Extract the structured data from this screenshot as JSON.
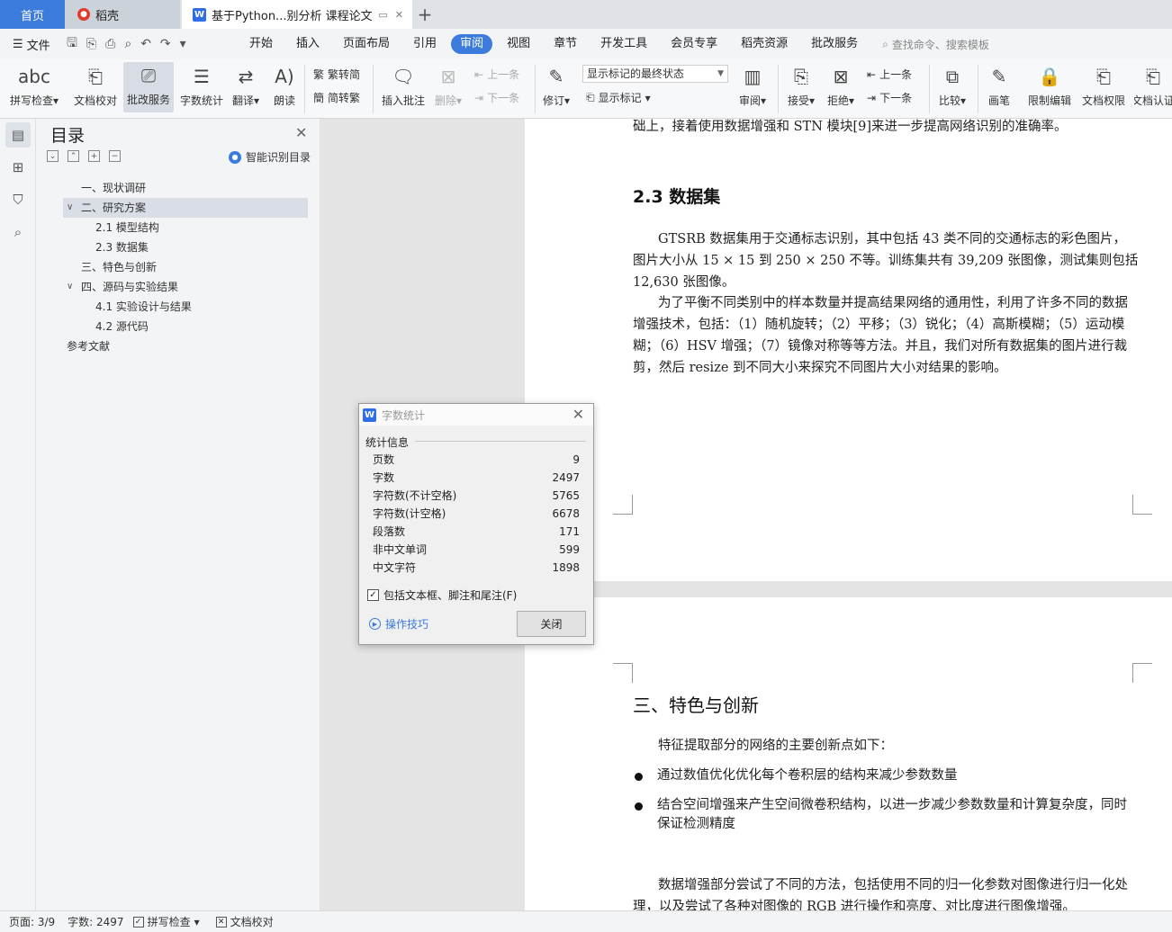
{
  "tabs": {
    "home": "首页",
    "daoke": "稻壳",
    "doc": "基于Python...别分析 课程论文",
    "new": "+"
  },
  "menubar": {
    "file": "文件",
    "items": [
      "开始",
      "插入",
      "页面布局",
      "引用",
      "审阅",
      "视图",
      "章节",
      "开发工具",
      "会员专享",
      "稻壳资源",
      "批改服务"
    ],
    "active": "审阅",
    "search_placeholder": "查找命令、搜索模板"
  },
  "ribbon": {
    "spellcheck": "拼写检查",
    "doc_proof": "文档校对",
    "correct_service": "批改服务",
    "word_count": "字数统计",
    "translate": "翻译",
    "read_aloud": "朗读",
    "trad_to_simp": "繁转简",
    "simp_to_trad": "简转繁",
    "insert_comment": "插入批注",
    "delete": "删除",
    "prev": "上一条",
    "next": "下一条",
    "revise": "修订",
    "markup_state": "显示标记的最终状态",
    "show_markup": "显示标记",
    "review": "审阅",
    "accept": "接受",
    "reject": "拒绝",
    "prev2": "上一条",
    "next2": "下一条",
    "compare": "比较",
    "pen": "画笔",
    "restrict_edit": "限制编辑",
    "doc_rights": "文档权限",
    "doc_cert": "文档认证"
  },
  "toc": {
    "title": "目录",
    "smart": "智能识别目录",
    "items": [
      {
        "label": "一、现状调研",
        "level": 1,
        "expanded": null
      },
      {
        "label": "二、研究方案",
        "level": 1,
        "expanded": true,
        "selected": true
      },
      {
        "label": "2.1  模型结构",
        "level": 2
      },
      {
        "label": "2.3  数据集",
        "level": 2
      },
      {
        "label": "三、特色与创新",
        "level": 1
      },
      {
        "label": "四、源码与实验结果",
        "level": 1,
        "expanded": true
      },
      {
        "label": "4.1  实验设计与结果",
        "level": 2
      },
      {
        "label": "4.2  源代码",
        "level": 2
      },
      {
        "label": "参考文献",
        "level": 0
      }
    ]
  },
  "document": {
    "line_top": "础上，接着使用数据增强和 STN 模块[9]来进一步提高网络识别的准确率。",
    "h_dataset": "2.3  数据集",
    "p1": "GTSRB 数据集用于交通标志识别，其中包括 43 类不同的交通标志的彩色图片，图片大小从 15 × 15 到 250 × 250 不等。训练集共有 39,209 张图像，测试集则包括 12,630 张图像。",
    "p2": "为了平衡不同类别中的样本数量并提高结果网络的通用性，利用了许多不同的数据增强技术，包括：（1）随机旋转；（2）平移；（3）锐化；（4）高斯模糊；（5）运动模糊；（6）HSV 增强；（7）镜像对称等等方法。并且，我们对所有数据集的图片进行裁剪，然后 resize 到不同大小来探究不同图片大小对结果的影响。",
    "h_feature": "三、特色与创新",
    "p3": "特征提取部分的网络的主要创新点如下：",
    "bullet1": "通过数值优化优化每个卷积层的结构来减少参数数量",
    "bullet2": "结合空间增强来产生空间微卷积结构，以进一步减少参数数量和计算复杂度，同时保证检测精度",
    "p4": "数据增强部分尝试了不同的方法，包括使用不同的归一化参数对图像进行归一化处理，以及尝试了各种对图像的 RGB 进行操作和亮度、对比度进行图像增强。"
  },
  "dialog": {
    "title": "字数统计",
    "section": "统计信息",
    "rows": [
      {
        "label": "页数",
        "value": "9"
      },
      {
        "label": "字数",
        "value": "2497"
      },
      {
        "label": "字符数(不计空格)",
        "value": "5765"
      },
      {
        "label": "字符数(计空格)",
        "value": "6678"
      },
      {
        "label": "段落数",
        "value": "171"
      },
      {
        "label": "非中文单词",
        "value": "599"
      },
      {
        "label": "中文字符",
        "value": "1898"
      }
    ],
    "include_label": "包括文本框、脚注和尾注(F)",
    "include_checked": true,
    "tips": "操作技巧",
    "close": "关闭"
  },
  "statusbar": {
    "page": "页面: 3/9",
    "words": "字数: 2497",
    "spell": "拼写检查",
    "proof": "文档校对"
  },
  "colors": {
    "accent": "#3b7bdc"
  }
}
